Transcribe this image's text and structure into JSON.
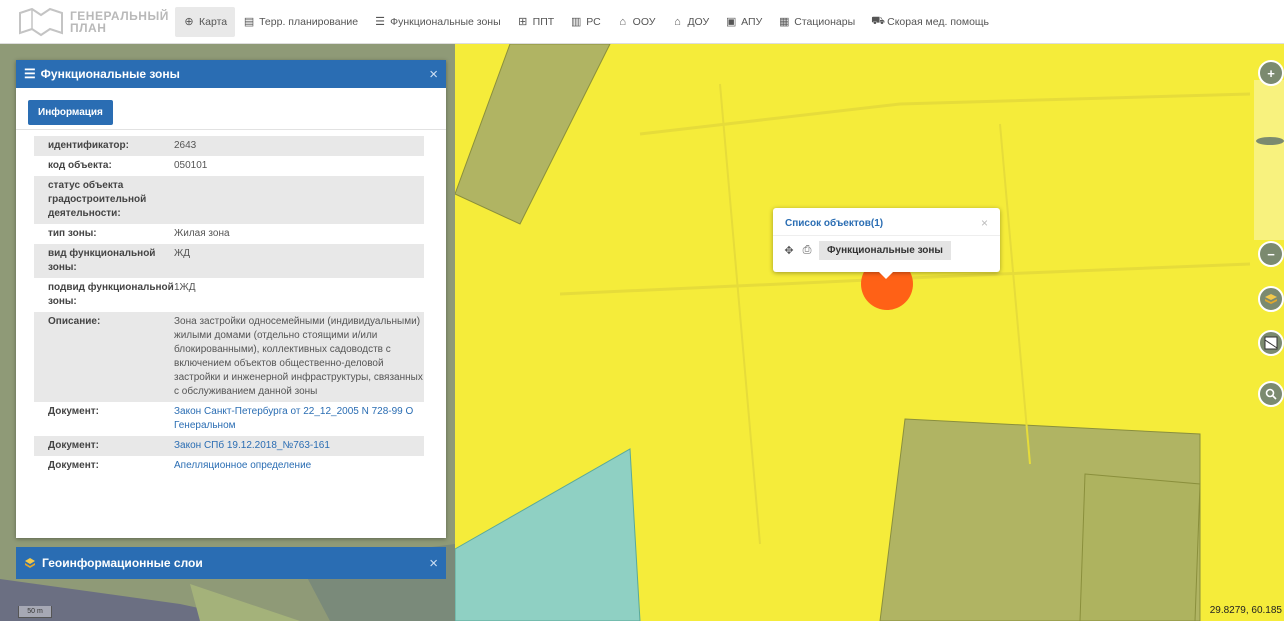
{
  "logo": {
    "line1": "ГЕНЕРАЛЬНЫЙ",
    "line2": "ПЛАН"
  },
  "nav": [
    {
      "label": "Карта",
      "icon": "globe-icon",
      "glyph": "⊕",
      "active": true
    },
    {
      "label": "Терр. планирование",
      "icon": "document-icon",
      "glyph": "▤",
      "active": false
    },
    {
      "label": "Функциональные зоны",
      "icon": "list-icon",
      "glyph": "☰",
      "active": false
    },
    {
      "label": "ППТ",
      "icon": "grid-icon",
      "glyph": "⊞",
      "active": false
    },
    {
      "label": "РС",
      "icon": "book-icon",
      "glyph": "▥",
      "active": false
    },
    {
      "label": "ООУ",
      "icon": "building-icon",
      "glyph": "⌂",
      "active": false
    },
    {
      "label": "ДОУ",
      "icon": "house-icon",
      "glyph": "⌂",
      "active": false
    },
    {
      "label": "АПУ",
      "icon": "image-icon",
      "glyph": "▣",
      "active": false
    },
    {
      "label": "Стационары",
      "icon": "hospital-icon",
      "glyph": "▦",
      "active": false
    },
    {
      "label": "Скорая мед. помощь",
      "icon": "ambulance-icon",
      "glyph": "⛟",
      "active": false
    }
  ],
  "panel": {
    "title": "Функциональные зоны",
    "tab_label": "Информация",
    "rows": [
      {
        "key": "идентификатор:",
        "value": "2643",
        "link": false
      },
      {
        "key": "код объекта:",
        "value": "050101",
        "link": false
      },
      {
        "key": "статус объекта градостроительной деятельности:",
        "value": "",
        "link": false
      },
      {
        "key": "тип зоны:",
        "value": "Жилая зона",
        "link": false
      },
      {
        "key": "вид функциональной зоны:",
        "value": "ЖД",
        "link": false
      },
      {
        "key": "подвид функциональной зоны:",
        "value": "1ЖД",
        "link": false
      },
      {
        "key": "Описание:",
        "value": "Зона застройки односемейными (индивидуальными) жилыми домами (отдельно стоящими и/или блокированными), коллективных садоводств с включением объектов общественно-деловой застройки и инженерной инфраструктуры, связанных с обслуживанием данной зоны",
        "link": false
      },
      {
        "key": "Документ:",
        "value": "Закон Санкт-Петербурга от 22_12_2005 N 728-99 О Генеральном",
        "link": true
      },
      {
        "key": "Документ:",
        "value": "Закон СПб 19.12.2018_№763-161",
        "link": true
      },
      {
        "key": "Документ:",
        "value": "Апелляционное определение",
        "link": true
      }
    ]
  },
  "panel2": {
    "title": "Геоинформационные слои"
  },
  "popup": {
    "title": "Список объектов(1)",
    "chip": "Функциональные зоны"
  },
  "controls": {
    "zoom_in": "+",
    "zoom_out": "−"
  },
  "scale": "50 m",
  "coords": "29.8279, 60.185",
  "colors": {
    "accent": "#2a6db3",
    "map_yellow": "#f5ec3a",
    "marker": "#ff5a14",
    "panel_head": "#2a6db3"
  }
}
